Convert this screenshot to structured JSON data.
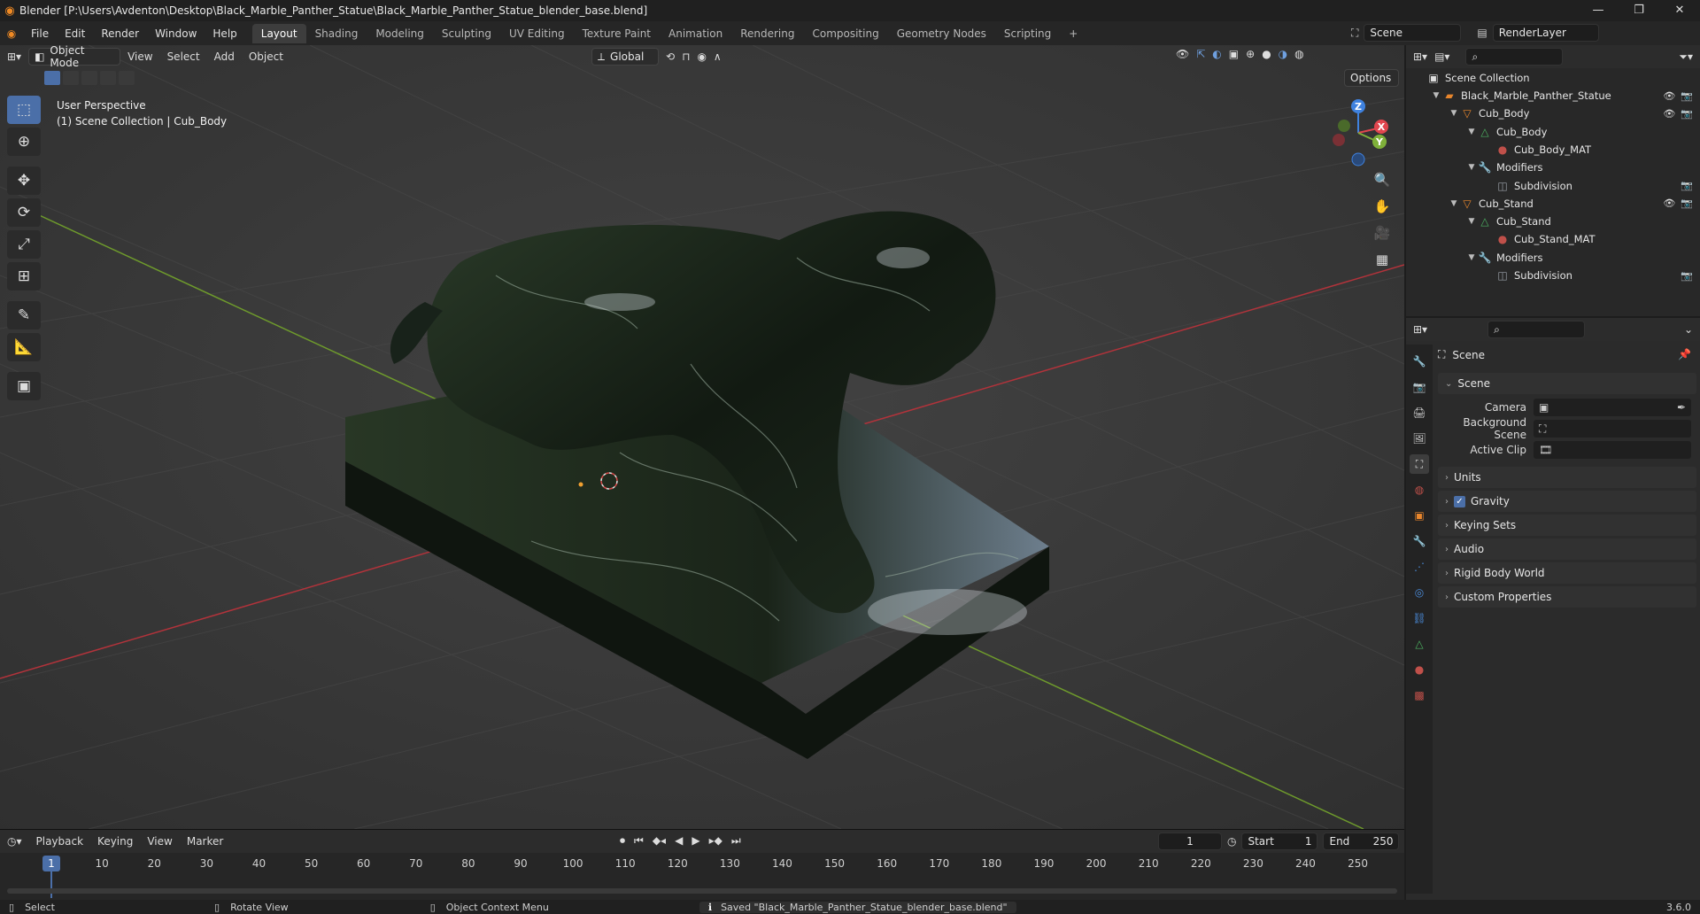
{
  "window": {
    "title": "Blender [P:\\Users\\Avdenton\\Desktop\\Black_Marble_Panther_Statue\\Black_Marble_Panther_Statue_blender_base.blend]",
    "minimize": "—",
    "maximize": "❐",
    "close": "✕"
  },
  "menu": [
    "File",
    "Edit",
    "Render",
    "Window",
    "Help"
  ],
  "workspaces": [
    "Layout",
    "Shading",
    "Modeling",
    "Sculpting",
    "UV Editing",
    "Texture Paint",
    "Animation",
    "Rendering",
    "Compositing",
    "Geometry Nodes",
    "Scripting",
    "+"
  ],
  "scene_field": "Scene",
  "renderlayer_field": "RenderLayer",
  "viewport": {
    "mode": "Object Mode",
    "menus": [
      "View",
      "Select",
      "Add",
      "Object"
    ],
    "orientation": "Global",
    "options": "Options",
    "perspective_label": "User Perspective",
    "collection_label": "(1) Scene Collection | Cub_Body",
    "gizmo": {
      "x": "X",
      "y": "Y",
      "z": "Z"
    }
  },
  "outliner": {
    "root": "Scene Collection",
    "rows": [
      {
        "label": "Black_Marble_Panther_Statue",
        "level": 1,
        "icon": "collection-icon"
      },
      {
        "label": "Cub_Body",
        "level": 2,
        "icon": "object-icon"
      },
      {
        "label": "Cub_Body",
        "level": 3,
        "icon": "mesh-icon"
      },
      {
        "label": "Cub_Body_MAT",
        "level": 4,
        "icon": "material-icon"
      },
      {
        "label": "Modifiers",
        "level": 3,
        "icon": "wrench-icon"
      },
      {
        "label": "Subdivision",
        "level": 4,
        "icon": "modifier-icon"
      },
      {
        "label": "Cub_Stand",
        "level": 2,
        "icon": "object-icon"
      },
      {
        "label": "Cub_Stand",
        "level": 3,
        "icon": "mesh-icon"
      },
      {
        "label": "Cub_Stand_MAT",
        "level": 4,
        "icon": "material-icon"
      },
      {
        "label": "Modifiers",
        "level": 3,
        "icon": "wrench-icon"
      },
      {
        "label": "Subdivision",
        "level": 4,
        "icon": "modifier-icon"
      }
    ]
  },
  "properties": {
    "context": "Scene",
    "section": "Scene",
    "fields": [
      {
        "label": "Camera",
        "value": ""
      },
      {
        "label": "Background Scene",
        "value": ""
      },
      {
        "label": "Active Clip",
        "value": ""
      }
    ],
    "panels": [
      "Units",
      "Gravity",
      "Keying Sets",
      "Audio",
      "Rigid Body World",
      "Custom Properties"
    ]
  },
  "timeline": {
    "menus": [
      "Playback",
      "Keying",
      "View",
      "Marker"
    ],
    "current_frame": "1",
    "start_label": "Start",
    "start": "1",
    "end_label": "End",
    "end": "250",
    "ticks": [
      "1",
      "10",
      "20",
      "30",
      "40",
      "50",
      "60",
      "70",
      "80",
      "90",
      "100",
      "110",
      "120",
      "130",
      "140",
      "150",
      "160",
      "170",
      "180",
      "190",
      "200",
      "210",
      "220",
      "230",
      "240",
      "250"
    ]
  },
  "status": {
    "select": "Select",
    "rotate": "Rotate View",
    "context": "Object Context Menu",
    "message": "Saved \"Black_Marble_Panther_Statue_blender_base.blend\"",
    "version": "3.6.0"
  },
  "colors": {
    "accent": "#4b6fa8",
    "orange": "#e8862c",
    "x_axis": "#e0464e",
    "y_axis": "#7fb03a",
    "z_axis": "#3f82df"
  }
}
